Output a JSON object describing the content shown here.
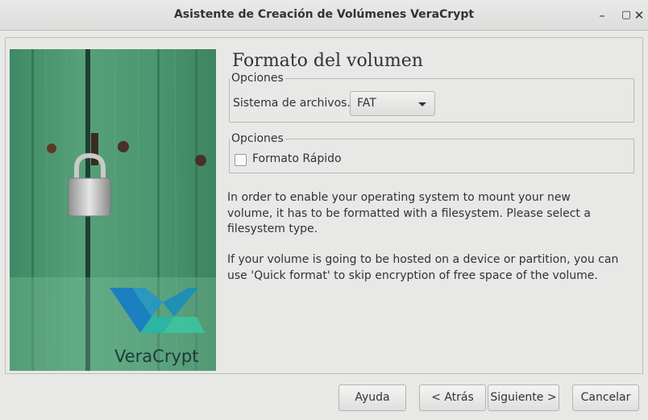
{
  "window": {
    "title": "Asistente de Creación de Volúmenes VeraCrypt",
    "minimize_icon": "minimize-icon",
    "maximize_icon": "maximize-icon",
    "close_icon": "close-icon"
  },
  "page": {
    "heading": "Formato del volumen"
  },
  "options_group_1": {
    "label": "Opciones",
    "filesystem_label": "Sistema de archivos.",
    "filesystem_value": "FAT"
  },
  "options_group_2": {
    "label": "Opciones",
    "quick_format_label": "Formato Rápido",
    "quick_format_checked": false
  },
  "info": {
    "paragraph1": [
      "In order to enable your operating system to mount your new",
      "volume, it has to be formatted with a filesystem. Please select a",
      "filesystem type."
    ],
    "paragraph2": [
      "If your volume is going to be hosted on a device or partition, you can",
      "use 'Quick format' to skip encryption of free space of the volume."
    ]
  },
  "buttons": {
    "help": "Ayuda",
    "back": "< Atrás",
    "next": "Siguiente >",
    "cancel": "Cancelar"
  },
  "brand": {
    "logo_text": "VeraCrypt"
  },
  "colors": {
    "window_bg": "#e8e8e7",
    "door_green": "#4f9a72",
    "logo_blue": "#1c7fbf",
    "logo_teal": "#2bb5a2"
  }
}
